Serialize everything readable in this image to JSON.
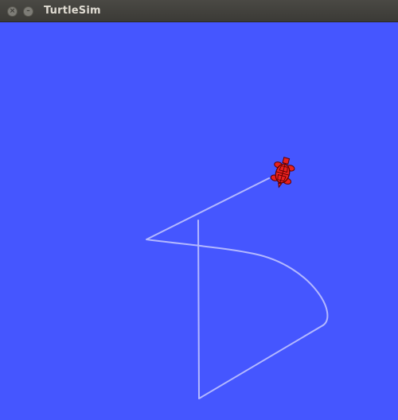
{
  "window": {
    "title": "TurtleSim",
    "close_icon": "close-icon",
    "minimize_icon": "minimize-icon",
    "close_glyph": "×",
    "minimize_glyph": "–"
  },
  "canvas": {
    "background_color": "#4556ff",
    "pen_color": "#b3b8ff"
  },
  "turtle": {
    "icon": "turtle-icon",
    "color": "#e8211f",
    "outline_color": "#5a0000"
  }
}
